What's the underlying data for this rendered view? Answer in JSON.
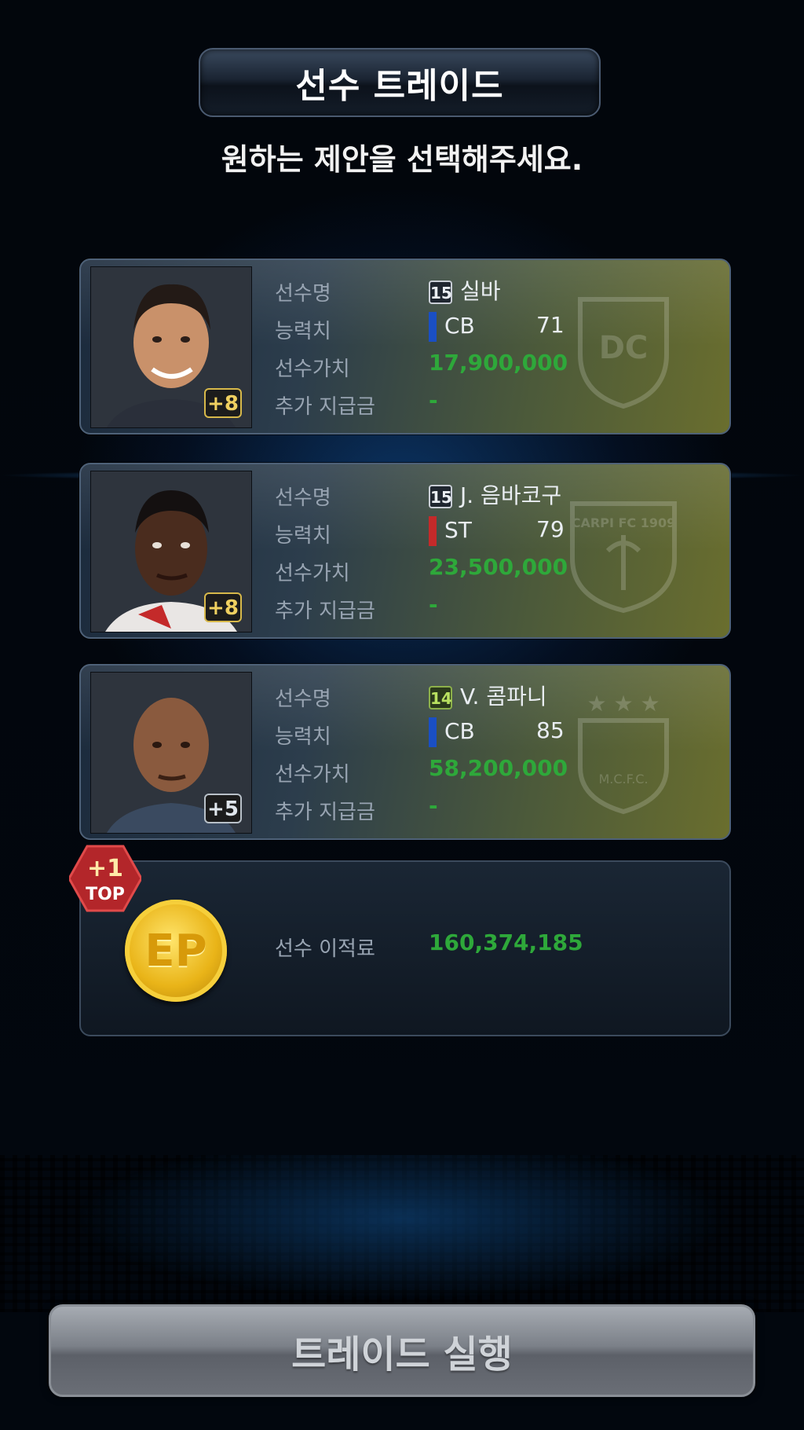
{
  "header": {
    "title": "선수 트레이드"
  },
  "subtitle": "원하는 제안을 선택해주세요.",
  "labels": {
    "name": "선수명",
    "ability": "능력치",
    "value": "선수가치",
    "extra": "추가 지급금",
    "transfer_fee": "선수 이적료"
  },
  "players": [
    {
      "grade": "15",
      "name": "실바",
      "position": "CB",
      "position_color": "#1a4fc4",
      "rating": "71",
      "value": "17,900,000",
      "extra": "-",
      "enhance": "+8",
      "crest_text": "DC FC"
    },
    {
      "grade": "15",
      "name": "J. 음바코구",
      "position": "ST",
      "position_color": "#c42a2a",
      "rating": "79",
      "value": "23,500,000",
      "extra": "-",
      "enhance": "+8",
      "crest_text": "CARPI FC 1909"
    },
    {
      "grade": "14",
      "name": "V. 콤파니",
      "position": "CB",
      "position_color": "#1a4fc4",
      "rating": "85",
      "value": "58,200,000",
      "extra": "-",
      "enhance": "+5",
      "crest_text": "M.C.F.C."
    }
  ],
  "ep_offer": {
    "coin_label": "EP",
    "badge_plus": "+1",
    "badge_text": "TOP",
    "fee": "160,374,185"
  },
  "action_button": "트레이드 실행",
  "colors": {
    "value_green": "#2ea83a",
    "accent_blue": "#1a6fd0"
  }
}
